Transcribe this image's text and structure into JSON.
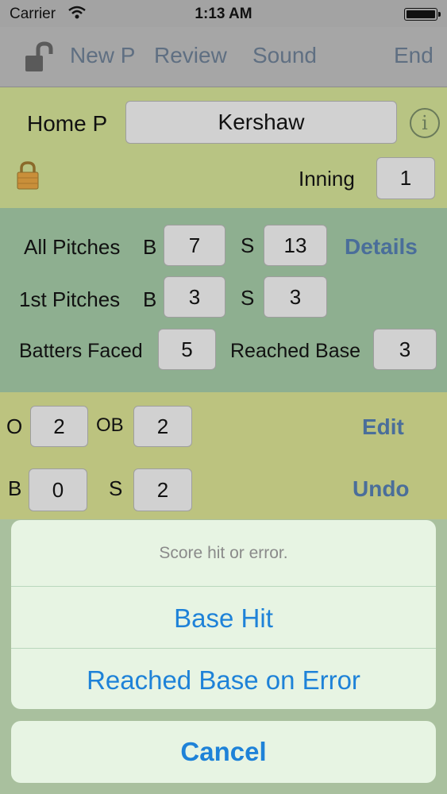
{
  "status_bar": {
    "carrier": "Carrier",
    "time": "1:13 AM"
  },
  "toolbar": {
    "new_p": "New P",
    "review": "Review",
    "sound": "Sound",
    "end": "End"
  },
  "pitcher": {
    "label": "Home P",
    "name": "Kershaw",
    "info": "i",
    "inning_label": "Inning",
    "inning": "1"
  },
  "pitches": {
    "all_label": "All Pitches",
    "all_b_label": "B",
    "all_b": "7",
    "all_s_label": "S",
    "all_s": "13",
    "details": "Details",
    "first_label": "1st Pitches",
    "first_b_label": "B",
    "first_b": "3",
    "first_s_label": "S",
    "first_s": "3",
    "batters_label": "Batters Faced",
    "batters": "5",
    "reached_label": "Reached Base",
    "reached": "3"
  },
  "count": {
    "o_label": "O",
    "o": "2",
    "ob_label": "OB",
    "ob": "2",
    "edit": "Edit",
    "b_label": "B",
    "b": "0",
    "s_label": "S",
    "s": "2",
    "undo": "Undo"
  },
  "action_sheet": {
    "title": "Score hit or error.",
    "option1": "Base Hit",
    "option2": "Reached Base on Error",
    "cancel": "Cancel"
  },
  "colors": {
    "accent_blue": "#1e82d8",
    "link_blue": "#4a6e9a",
    "section_yellow": "#b8c483",
    "section_green": "#8eaf90"
  }
}
